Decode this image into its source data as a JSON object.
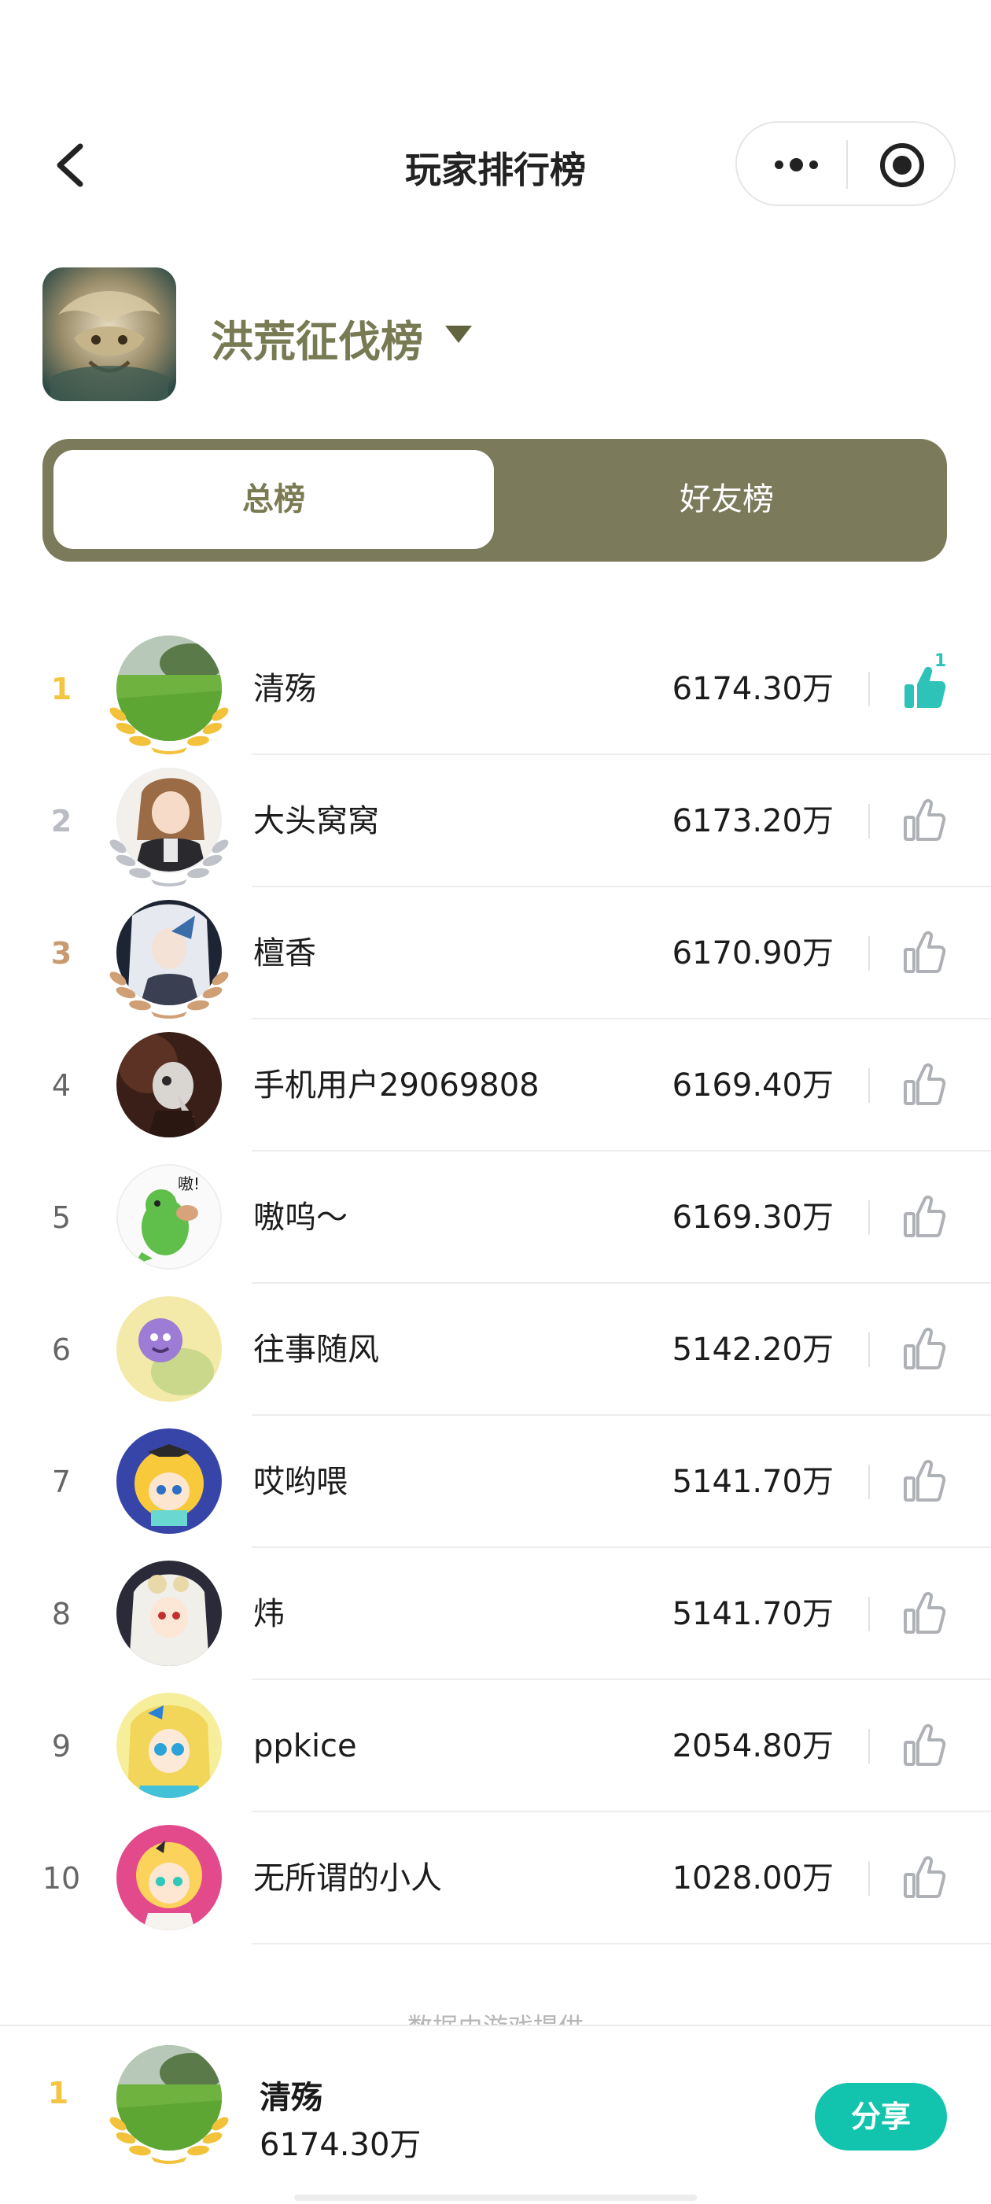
{
  "nav": {
    "title": "玩家排行榜"
  },
  "game": {
    "title": "洪荒征伐榜"
  },
  "tabs": [
    {
      "label": "总榜",
      "active": true
    },
    {
      "label": "好友榜",
      "active": false
    }
  ],
  "colors": {
    "accent_olive": "#7b7b5c",
    "like_active": "#2dc3b8",
    "share_button": "#12c4ad",
    "rank_gold": "#f4c542",
    "rank_silver": "#b9bcc2",
    "rank_bronze": "#c99a6e"
  },
  "ranking": [
    {
      "rank": "1",
      "name": "清殇",
      "score": "6174.30万",
      "liked": true,
      "likes": "1",
      "laurel": "gold"
    },
    {
      "rank": "2",
      "name": "大头窝窝",
      "score": "6173.20万",
      "liked": false,
      "laurel": "silver"
    },
    {
      "rank": "3",
      "name": "檀香",
      "score": "6170.90万",
      "liked": false,
      "laurel": "bronze"
    },
    {
      "rank": "4",
      "name": "手机用户29069808",
      "score": "6169.40万",
      "liked": false
    },
    {
      "rank": "5",
      "name": "嗷呜～",
      "score": "6169.30万",
      "liked": false
    },
    {
      "rank": "6",
      "name": "往事随风",
      "score": "5142.20万",
      "liked": false
    },
    {
      "rank": "7",
      "name": "哎哟喂",
      "score": "5141.70万",
      "liked": false
    },
    {
      "rank": "8",
      "name": "炜",
      "score": "5141.70万",
      "liked": false
    },
    {
      "rank": "9",
      "name": "ppkice",
      "score": "2054.80万",
      "liked": false
    },
    {
      "rank": "10",
      "name": "无所谓的小人",
      "score": "1028.00万",
      "liked": false
    }
  ],
  "footer": {
    "note": "数据由游戏提供"
  },
  "me": {
    "rank": "1",
    "name": "清殇",
    "score": "6174.30万"
  },
  "share": {
    "label": "分享"
  }
}
